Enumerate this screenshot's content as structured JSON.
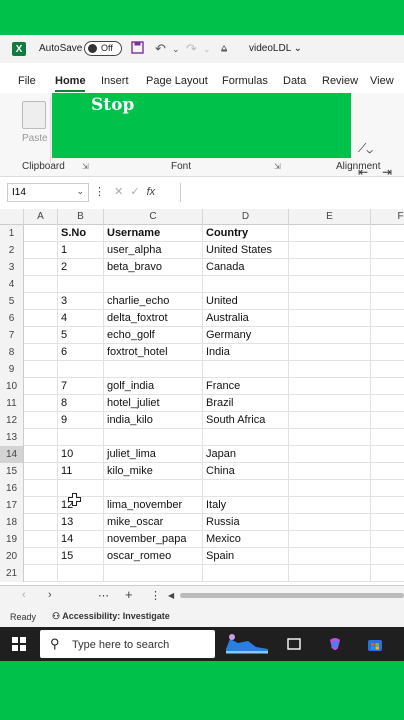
{
  "titlebar": {
    "app_letter": "X",
    "autosave_label": "AutoSave",
    "autosave_state": "Off",
    "document_title": "videoLDL ⌄"
  },
  "tabs": [
    "File",
    "Home",
    "Insert",
    "Page Layout",
    "Formulas",
    "Data",
    "Review",
    "View"
  ],
  "ribbon": {
    "paste_label": "Paste",
    "overlay_text": "Stop",
    "groups": [
      "Clipboard",
      "Font",
      "Alignment"
    ]
  },
  "formula_bar": {
    "name_box": "I14",
    "fx": "fx"
  },
  "columns": [
    "A",
    "B",
    "C",
    "D",
    "E",
    "F"
  ],
  "rows": [
    {
      "n": "1",
      "b": "S.No",
      "c": "Username",
      "d": "Country",
      "hdr": true
    },
    {
      "n": "2",
      "b": "1",
      "c": "user_alpha",
      "d": "United States"
    },
    {
      "n": "3",
      "b": "2",
      "c": "beta_bravo",
      "d": "Canada"
    },
    {
      "n": "4",
      "b": "",
      "c": "",
      "d": ""
    },
    {
      "n": "5",
      "b": "3",
      "c": "charlie_echo",
      "d": "United"
    },
    {
      "n": "6",
      "b": "4",
      "c": "delta_foxtrot",
      "d": "Australia"
    },
    {
      "n": "7",
      "b": "5",
      "c": "echo_golf",
      "d": "Germany"
    },
    {
      "n": "8",
      "b": "6",
      "c": "foxtrot_hotel",
      "d": "India"
    },
    {
      "n": "9",
      "b": "",
      "c": "",
      "d": ""
    },
    {
      "n": "10",
      "b": "7",
      "c": "golf_india",
      "d": "France"
    },
    {
      "n": "11",
      "b": "8",
      "c": "hotel_juliet",
      "d": "Brazil"
    },
    {
      "n": "12",
      "b": "9",
      "c": "india_kilo",
      "d": "South Africa"
    },
    {
      "n": "13",
      "b": "",
      "c": "",
      "d": ""
    },
    {
      "n": "14",
      "b": "10",
      "c": "juliet_lima",
      "d": "Japan",
      "sel": true
    },
    {
      "n": "15",
      "b": "11",
      "c": "kilo_mike",
      "d": "China"
    },
    {
      "n": "16",
      "b": "",
      "c": "",
      "d": ""
    },
    {
      "n": "17",
      "b": "12",
      "c": "lima_november",
      "d": "Italy"
    },
    {
      "n": "18",
      "b": "13",
      "c": "mike_oscar",
      "d": "Russia"
    },
    {
      "n": "19",
      "b": "14",
      "c": "november_papa",
      "d": "Mexico"
    },
    {
      "n": "20",
      "b": "15",
      "c": "oscar_romeo",
      "d": "Spain"
    },
    {
      "n": "21",
      "b": "",
      "c": "",
      "d": ""
    }
  ],
  "statusbar": {
    "ready": "Ready",
    "accessibility": "Accessibility: Investigate"
  },
  "taskbar": {
    "search_placeholder": "Type here to search"
  },
  "colors": {
    "excel_green": "#107c41",
    "background_green": "#00c24a"
  }
}
